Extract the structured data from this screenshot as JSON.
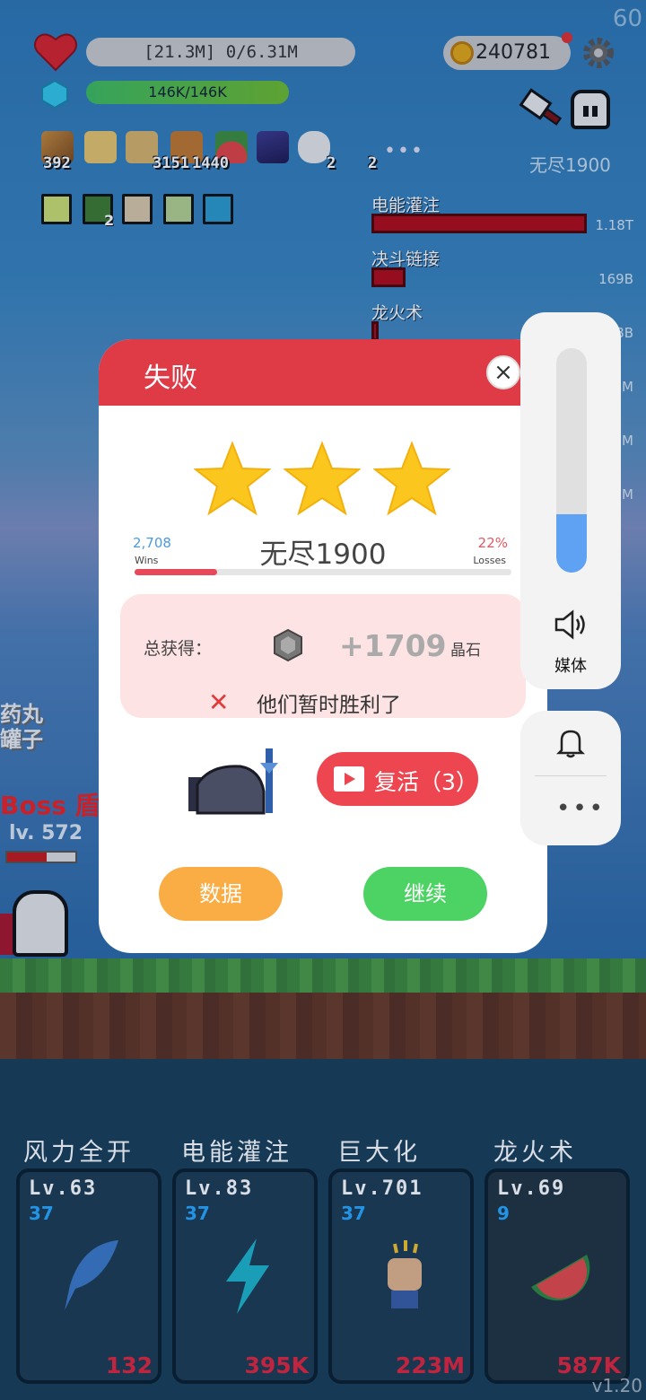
{
  "hud": {
    "fps": "60",
    "hp_text": "[21.3M] 0/6.31M",
    "mp_text": "146K/146K",
    "coins": "240781",
    "stage_label": "无尽1900",
    "more": "•••"
  },
  "inventory": {
    "items": [
      {
        "icon": "bow-icon",
        "count": "392"
      },
      {
        "icon": "scroll-icon",
        "count": ""
      },
      {
        "icon": "map-icon",
        "count": ""
      },
      {
        "icon": "book-icon",
        "count": "3151"
      },
      {
        "icon": "watermelon-icon",
        "count": "1440"
      },
      {
        "icon": "wizard-hat-icon",
        "count": ""
      },
      {
        "icon": "chat-icon",
        "count": "2"
      },
      {
        "icon": "blank-icon",
        "count": "2"
      }
    ],
    "buffs": [
      {
        "icon": "light-buff-icon",
        "count": ""
      },
      {
        "icon": "poison-buff-icon",
        "count": "2"
      },
      {
        "icon": "cloud-buff-icon",
        "count": ""
      },
      {
        "icon": "plant-buff-icon",
        "count": ""
      },
      {
        "icon": "vortex-buff-icon",
        "count": ""
      }
    ]
  },
  "damage": [
    {
      "label": "电能灌注",
      "value": "1.18T"
    },
    {
      "label": "决斗链接",
      "value": "169B"
    },
    {
      "label": "龙火术",
      "value": "8B"
    },
    {
      "label": "",
      "value": "3M"
    },
    {
      "label": "",
      "value": "2M"
    },
    {
      "label": "",
      "value": "8M"
    }
  ],
  "boss": {
    "left_text_1": "药丸",
    "left_text_2": "罐子",
    "label": "Boss",
    "shield": "盾",
    "level": "lv. 572",
    "hp_fraction": 0.58
  },
  "skills": [
    {
      "title": "风力全开",
      "level": "Lv.63",
      "sub": "37",
      "cost": "132",
      "icon": "feather-icon"
    },
    {
      "title": "电能灌注",
      "level": "Lv.83",
      "sub": "37",
      "cost": "395K",
      "icon": "lightning-icon"
    },
    {
      "title": "巨大化",
      "level": "Lv.701",
      "sub": "37",
      "cost": "223M",
      "icon": "fist-icon"
    },
    {
      "title": "龙火术",
      "level": "Lv.69",
      "sub": "9",
      "cost": "587K",
      "icon": "watermelon-icon"
    }
  ],
  "version": "v1.20",
  "dialog": {
    "title": "失败",
    "close": "×",
    "stars": 3,
    "wins_count": "2,708",
    "wins_label": "Wins",
    "losses_pct": "22%",
    "losses_label": "Losses",
    "stage_name": "无尽1900",
    "progress_fraction": 0.22,
    "reward_label": "总获得：",
    "reward_value": "+1709",
    "reward_unit": "晶石",
    "fail_icon": "✕",
    "fail_text": "他们暂时胜利了",
    "revive_label": "复活（3）",
    "data_button": "数据",
    "continue_button": "继续"
  },
  "volume": {
    "level_fraction": 0.26,
    "media_label": "媒体",
    "more": "•••"
  },
  "colors": {
    "header_red": "#de3b47",
    "revive_red": "#ee4650",
    "data_orange": "#fbad45",
    "continue_green": "#4cd363",
    "wins_blue": "#4a9ae0",
    "volume_blue": "#5fa2f4"
  }
}
